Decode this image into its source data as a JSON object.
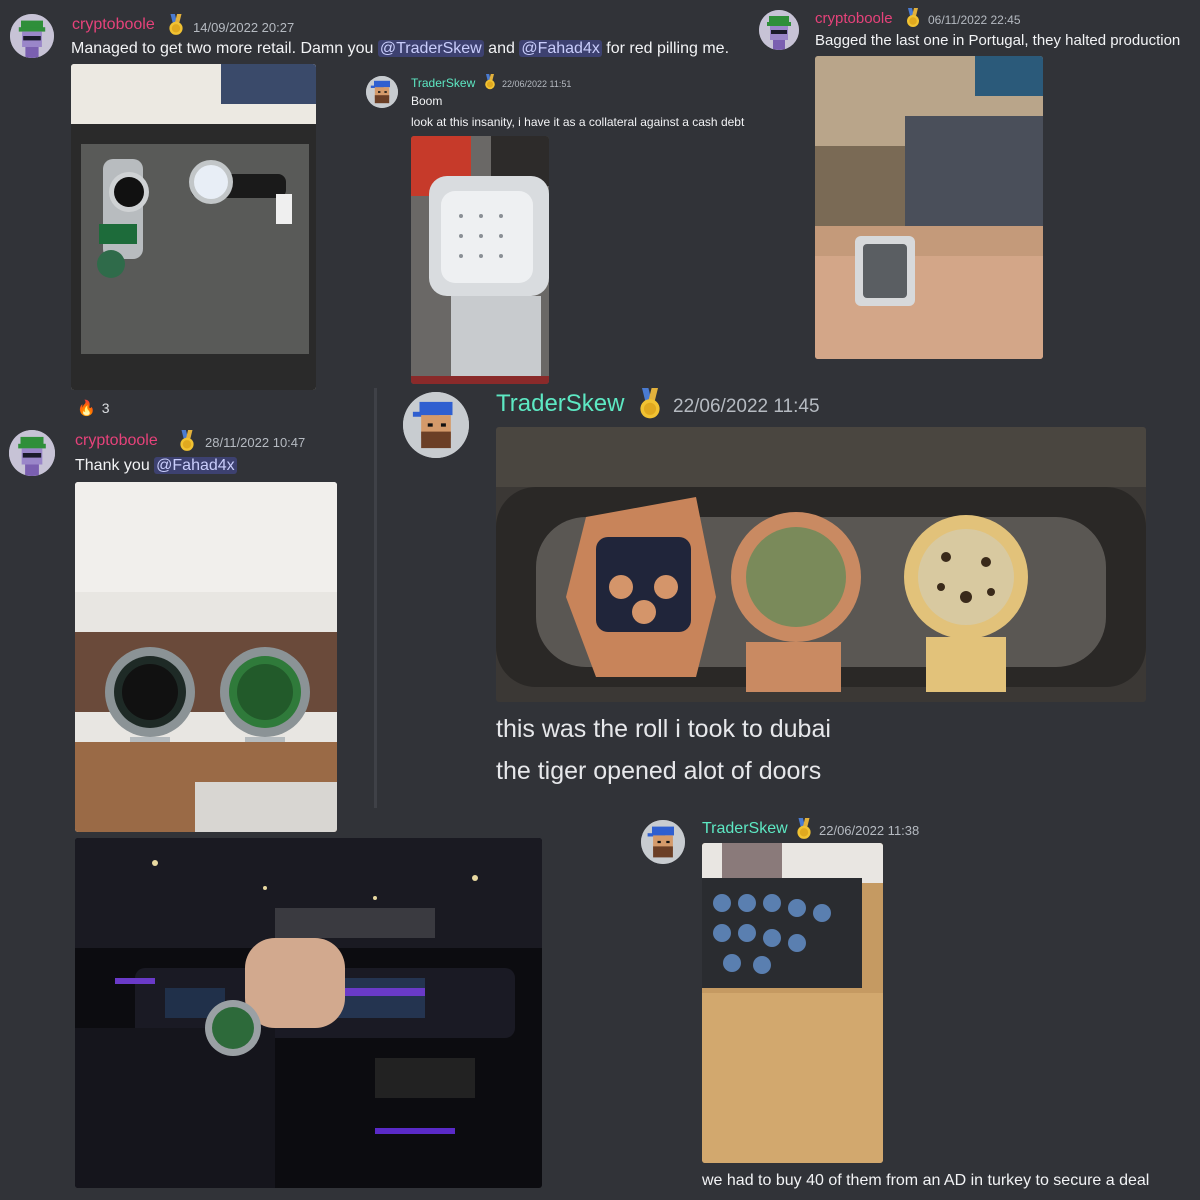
{
  "posts": {
    "top_left": {
      "username": "cryptoboole",
      "timestamp": "14/09/2022 20:27",
      "text_before": "Managed to get two more retail. Damn you ",
      "mention1": "@TraderSkew",
      "text_middle": " and ",
      "mention2": "@Fahad4x",
      "text_after": " for red pilling me.",
      "reaction_count": "3"
    },
    "top_middle": {
      "username": "TraderSkew",
      "timestamp": "22/06/2022 11:51",
      "line1": "Boom",
      "line2": "look at this insanity, i have it as a collateral against a cash debt"
    },
    "top_right": {
      "username": "cryptoboole",
      "timestamp": "06/11/2022 22:45",
      "text": "Bagged the last one in Portugal, they halted production"
    },
    "mid_left": {
      "username": "cryptoboole",
      "timestamp": "28/11/2022 10:47",
      "text_before": "Thank you ",
      "mention": "@Fahad4x"
    },
    "mid_right": {
      "username": "TraderSkew",
      "timestamp": "22/06/2022 11:45",
      "line1": "this was the roll i took to dubai",
      "line2": "the tiger opened alot of doors"
    },
    "bottom_right": {
      "username": "TraderSkew",
      "timestamp": "22/06/2022 11:38",
      "text": "we had to buy 40 of them from an AD in turkey to secure a deal"
    }
  },
  "icons": {
    "reaction": "fire-emoji",
    "badge": "gold-medal-icon"
  }
}
